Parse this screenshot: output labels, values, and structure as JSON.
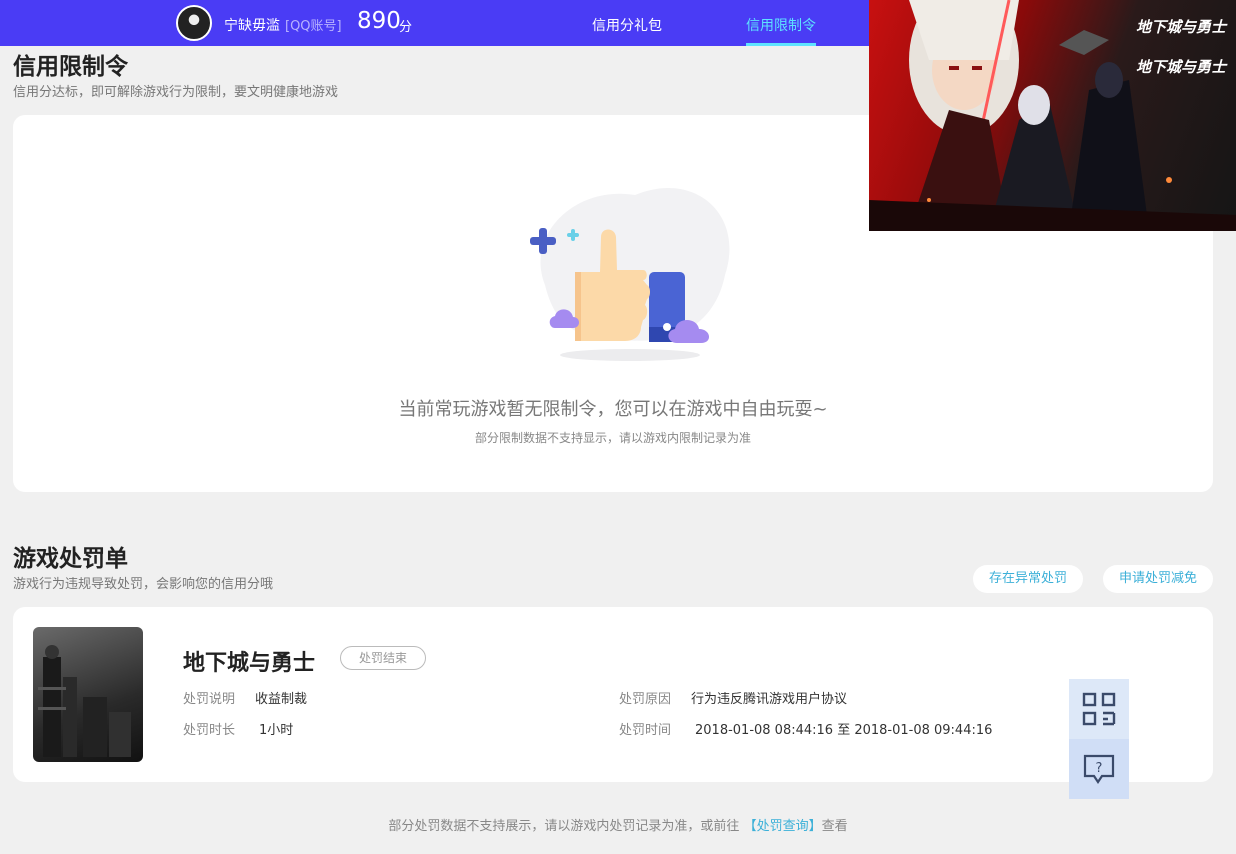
{
  "topbar": {
    "username": "宁缺毋滥",
    "account_type": "[QQ账号]",
    "score": "890",
    "score_unit": "分",
    "nav": [
      "信用分礼包",
      "信用限制令"
    ],
    "active_nav": "信用限制令"
  },
  "restriction": {
    "title": "信用限制令",
    "subtitle": "信用分达标，即可解除游戏行为限制，要文明健康地游戏",
    "empty_main": "当前常玩游戏暂无限制令，您可以在游戏中自由玩耍~",
    "empty_sub": "部分限制数据不支持显示，请以游戏内限制记录为准"
  },
  "penalty": {
    "title": "游戏处罚单",
    "subtitle": "游戏行为违规导致处罚，会影响您的信用分哦",
    "btn_abnormal": "存在异常处罚",
    "btn_reduce": "申请处罚减免",
    "game_name": "地下城与勇士",
    "status": "处罚结束",
    "desc_label": "处罚说明",
    "desc_value": "收益制裁",
    "reason_label": "处罚原因",
    "reason_value": "行为违反腾讯游戏用户协议",
    "duration_label": "处罚时长",
    "duration_value": "1小时",
    "time_label": "处罚时间",
    "time_value": "2018-01-08 08:44:16 至 2018-01-08 09:44:16"
  },
  "footer": {
    "text_before": "部分处罚数据不支持展示，请以游戏内处罚记录为准，或前往",
    "link": "【处罚查询】",
    "text_after": "查看"
  },
  "promo": {
    "logo_text": "地下城与勇士"
  },
  "colors": {
    "topbar": "#4a3cf5",
    "accent": "#3cb0d8",
    "active_nav": "#5ee3ff"
  }
}
